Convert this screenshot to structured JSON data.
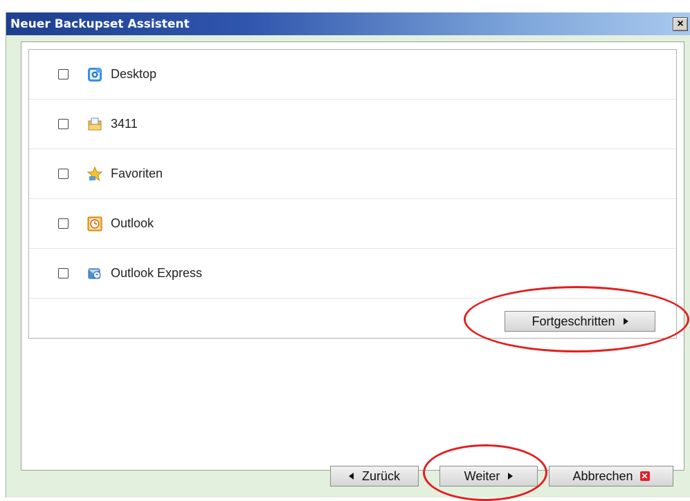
{
  "window": {
    "title": "Neuer Backupset Assistent",
    "close_label": "×"
  },
  "items": [
    {
      "label": "Desktop",
      "icon": "desktop-icon",
      "checked": false
    },
    {
      "label": "3411",
      "icon": "user-folder-icon",
      "checked": false
    },
    {
      "label": "Favoriten",
      "icon": "favorites-star-icon",
      "checked": false
    },
    {
      "label": "Outlook",
      "icon": "outlook-icon",
      "checked": false
    },
    {
      "label": "Outlook Express",
      "icon": "outlook-express-icon",
      "checked": false
    }
  ],
  "buttons": {
    "advanced": "Fortgeschritten",
    "back": "Zurück",
    "next": "Weiter",
    "cancel": "Abbrechen"
  },
  "colors": {
    "highlight": "#e41e1e",
    "window_bg": "#e3f0de",
    "title_start": "#1e3f8f"
  }
}
